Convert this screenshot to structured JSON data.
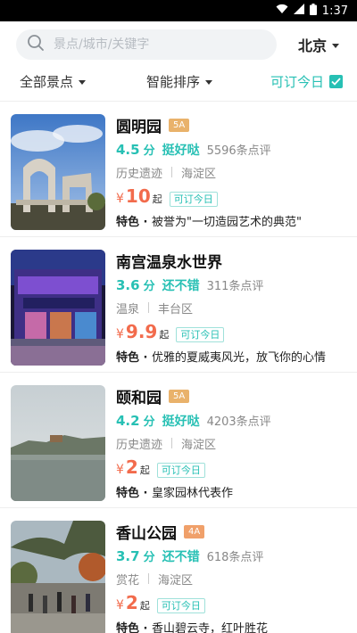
{
  "status_bar": {
    "time": "1:37",
    "icons": [
      "wifi-icon",
      "signal-icon",
      "battery-icon"
    ]
  },
  "search": {
    "placeholder": "景点/城市/关键字",
    "city": "北京"
  },
  "filters": {
    "all_label": "全部景点",
    "sort_label": "智能排序",
    "today_label": "可订今日",
    "today_checked": true
  },
  "colors": {
    "accent": "#27c0b4",
    "price": "#f26b4c",
    "badge": "#e9b26b"
  },
  "items": [
    {
      "name": "圆明园",
      "level": "5A",
      "score": "4.5",
      "score_unit": "分",
      "score_text": "挺好哒",
      "reviews": "5596条点评",
      "category": "历史遗迹",
      "district": "海淀区",
      "yen": "¥",
      "price": "10",
      "qi": "起",
      "today_tag": "可订今日",
      "feature_label": "特色 · ",
      "feature": "被誉为\"一切造园艺术的典范\""
    },
    {
      "name": "南宫温泉水世界",
      "level": "",
      "score": "3.6",
      "score_unit": "分",
      "score_text": "还不错",
      "reviews": "311条点评",
      "category": "温泉",
      "district": "丰台区",
      "yen": "¥",
      "price": "9.9",
      "qi": "起",
      "today_tag": "可订今日",
      "feature_label": "特色 · ",
      "feature": "优雅的夏威夷风光，放飞你的心情"
    },
    {
      "name": "颐和园",
      "level": "5A",
      "score": "4.2",
      "score_unit": "分",
      "score_text": "挺好哒",
      "reviews": "4203条点评",
      "category": "历史遗迹",
      "district": "海淀区",
      "yen": "¥",
      "price": "2",
      "qi": "起",
      "today_tag": "可订今日",
      "feature_label": "特色 · ",
      "feature": "皇家园林代表作"
    },
    {
      "name": "香山公园",
      "level": "4A",
      "score": "3.7",
      "score_unit": "分",
      "score_text": "还不错",
      "reviews": "618条点评",
      "category": "赏花",
      "district": "海淀区",
      "yen": "¥",
      "price": "2",
      "qi": "起",
      "today_tag": "可订今日",
      "feature_label": "特色 · ",
      "feature": "香山碧云寺，红叶胜花"
    }
  ]
}
